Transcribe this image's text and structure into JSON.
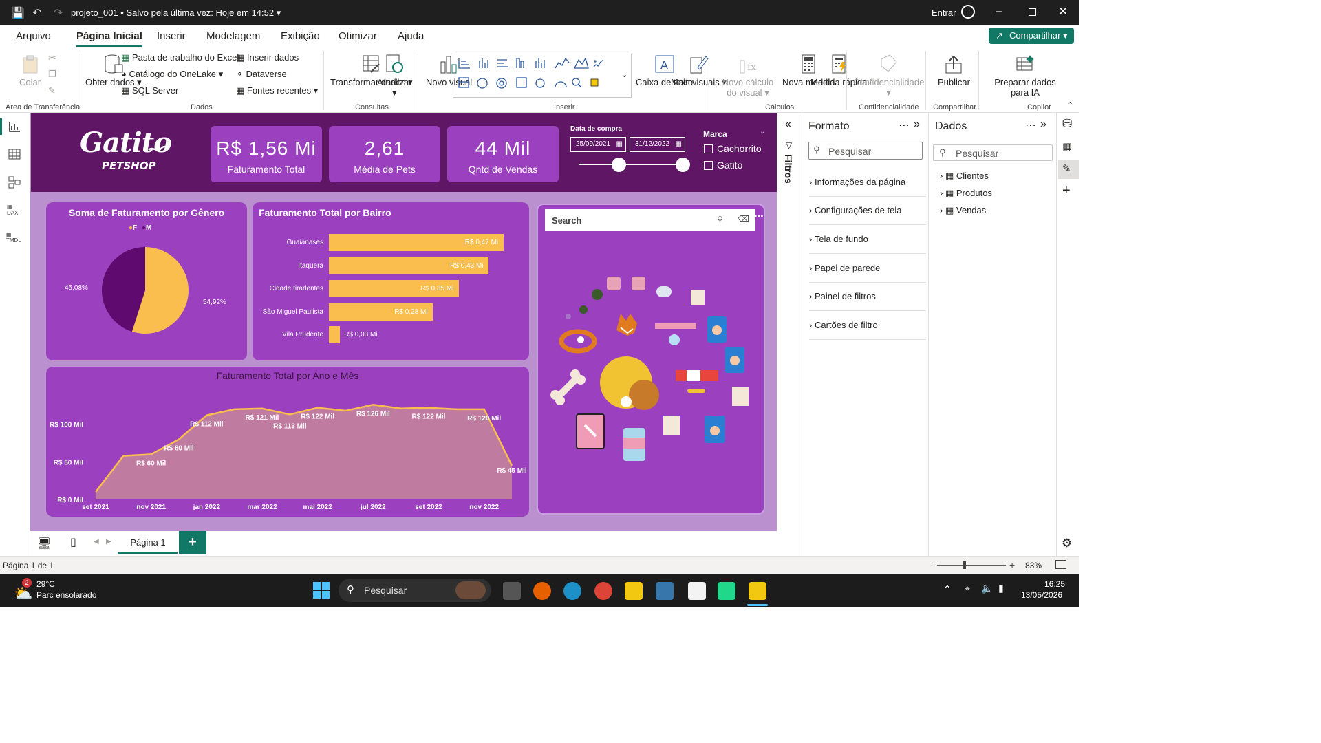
{
  "titlebar": {
    "title": "projeto_001",
    "saved": "• Salvo pela última vez: Hoje em 14:52",
    "signin": "Entrar"
  },
  "menu": [
    "Arquivo",
    "Página Inicial",
    "Inserir",
    "Modelagem",
    "Exibição",
    "Otimizar",
    "Ajuda"
  ],
  "share": "Compartilhar",
  "ribbon": {
    "paste": "Colar",
    "get_data": "Obter dados",
    "excel": "Pasta de trabalho do Excel",
    "onelake": "Catálogo do OneLake",
    "sql": "SQL Server",
    "insert_data": "Inserir dados",
    "dataverse": "Dataverse",
    "recent": "Fontes recentes",
    "transform": "Transformar dados",
    "refresh": "Atualizar",
    "new_visual": "Novo visual",
    "text_box": "Caixa de texto",
    "more_visuals": "Mais visuais",
    "new_calc": "Novo cálculo do visual",
    "new_measure": "Nova medida",
    "quick_measure": "Medida rápida",
    "sensitivity": "Confidencialidade",
    "publish": "Publicar",
    "prepare_ai": "Preparar dados para IA",
    "groups": {
      "clipboard": "Área de Transferência",
      "data": "Dados",
      "queries": "Consultas",
      "insert": "Inserir",
      "calcs": "Cálculos",
      "sensitivity": "Confidencialidade",
      "share": "Compartilhar",
      "copilot": "Copilot"
    }
  },
  "dashboard": {
    "logo_top": "Gatito",
    "logo_bottom": "PETSHOP",
    "kpis": [
      {
        "value": "R$ 1,56 Mi",
        "label": "Faturamento Total"
      },
      {
        "value": "2,61",
        "label": "Média de Pets"
      },
      {
        "value": "44 Mil",
        "label": "Qntd de Vendas"
      }
    ],
    "date_filter": {
      "label": "Data de compra",
      "start": "25/09/2021",
      "end": "31/12/2022"
    },
    "brand_filter": {
      "label": "Marca",
      "options": [
        "Cachorrito",
        "Gatito"
      ]
    },
    "search_placeholder": "Search"
  },
  "chart_data": [
    {
      "type": "pie",
      "title": "Soma de Faturamento por Gênero",
      "legend": [
        "F",
        "M"
      ],
      "values": [
        54.92,
        45.08
      ],
      "value_labels": [
        "54,92%",
        "45,08%"
      ],
      "colors": [
        "#f9be4d",
        "#5e0a6e"
      ]
    },
    {
      "type": "bar",
      "orientation": "horizontal",
      "title": "Faturamento Total por Bairro",
      "categories": [
        "Guaianases",
        "Itaquera",
        "Cidade tiradentes",
        "São Miguel Paulista",
        "Vila Prudente"
      ],
      "values": [
        0.47,
        0.43,
        0.35,
        0.28,
        0.03
      ],
      "value_labels": [
        "R$ 0,47 Mi",
        "R$ 0,43 Mi",
        "R$ 0,35 Mi",
        "R$ 0,28 Mi",
        "R$ 0,03 Mi"
      ],
      "color": "#f9be4d"
    },
    {
      "type": "area",
      "title": "Faturamento Total por Ano e Mês",
      "x": [
        "set 2021",
        "out 2021",
        "nov 2021",
        "dez 2021",
        "jan 2022",
        "fev 2022",
        "mar 2022",
        "abr 2022",
        "mai 2022",
        "jun 2022",
        "jul 2022",
        "ago 2022",
        "set 2022",
        "out 2022",
        "nov 2022",
        "dez 2022"
      ],
      "x_tick_labels": [
        "set 2021",
        "nov 2021",
        "jan 2022",
        "mar 2022",
        "mai 2022",
        "jul 2022",
        "set 2022",
        "nov 2022"
      ],
      "values": [
        10,
        58,
        60,
        80,
        112,
        120,
        121,
        113,
        122,
        118,
        126,
        121,
        122,
        120,
        120,
        45
      ],
      "point_labels": [
        {
          "i": 2,
          "text": "R$ 60 Mil"
        },
        {
          "i": 3,
          "text": "R$ 80 Mil"
        },
        {
          "i": 4,
          "text": "R$ 112 Mil"
        },
        {
          "i": 6,
          "text": "R$ 121 Mil"
        },
        {
          "i": 7,
          "text": "R$ 113 Mil"
        },
        {
          "i": 8,
          "text": "R$ 122 Mil"
        },
        {
          "i": 10,
          "text": "R$ 126 Mil"
        },
        {
          "i": 12,
          "text": "R$ 122 Mil"
        },
        {
          "i": 14,
          "text": "R$ 120 Mil"
        },
        {
          "i": 15,
          "text": "R$ 45 Mil"
        }
      ],
      "y_ticks": [
        "R$ 0 Mil",
        "R$ 50 Mil",
        "R$ 100 Mil"
      ],
      "ylim": [
        0,
        140
      ],
      "fill": "#c07ca0",
      "line": "#f9be4d"
    }
  ],
  "format_pane": {
    "title": "Formato",
    "search": "Pesquisar",
    "items": [
      "Informações da página",
      "Configurações de tela",
      "Tela de fundo",
      "Papel de parede",
      "Painel de filtros",
      "Cartões de filtro"
    ]
  },
  "filters_label": "Filtros",
  "data_pane": {
    "title": "Dados",
    "search": "Pesquisar",
    "tables": [
      "Clientes",
      "Produtos",
      "Vendas"
    ]
  },
  "pages": {
    "tab": "Página 1",
    "add": "+"
  },
  "status": {
    "page": "Página 1 de 1",
    "zoom": "83%"
  },
  "taskbar": {
    "temp": "29°C",
    "weather": "Parc ensolarado",
    "badge": "2",
    "search": "Pesquisar",
    "time": "16:25",
    "date": "13/05/2026"
  }
}
